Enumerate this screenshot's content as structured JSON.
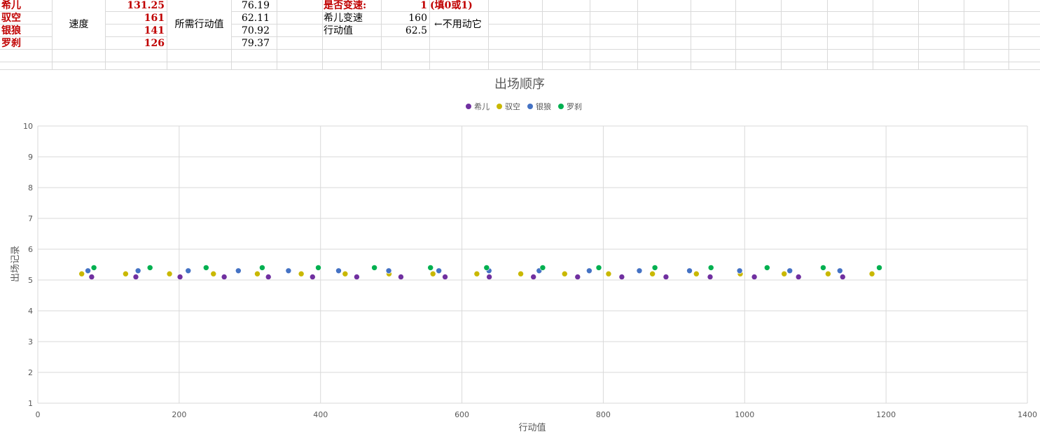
{
  "sheet": {
    "names": [
      "希儿",
      "驭空",
      "银狼",
      "罗刹"
    ],
    "speed_label": "速度",
    "speeds": [
      "131.25",
      "161",
      "141",
      "126"
    ],
    "req_label": "所需行动值",
    "req_values": [
      "76.19",
      "62.11",
      "70.92",
      "79.37"
    ],
    "change_label": "是否变速:",
    "change_value": "1",
    "change_hint": "(填0或1)",
    "seele_speed_label": "希儿变速",
    "seele_speed_value": "160",
    "action_label": "行动值",
    "action_value": "62.5",
    "note": "←不用动它"
  },
  "colors": {
    "希儿": "#7030a0",
    "驭空": "#c9b800",
    "银狼": "#4472c4",
    "罗刹": "#00b050"
  },
  "chart_data": {
    "type": "scatter",
    "title": "出场顺序",
    "xlabel": "行动值",
    "ylabel": "出场记录",
    "xlim": [
      0,
      1400
    ],
    "ylim": [
      1,
      10
    ],
    "xticks": [
      "0",
      "200",
      "400",
      "600",
      "800",
      "1000",
      "1200",
      "1400"
    ],
    "yticks": [
      "1",
      "2",
      "3",
      "4",
      "5",
      "6",
      "7",
      "8",
      "9",
      "10"
    ],
    "legend_position": "top",
    "grid": true,
    "series": [
      {
        "name": "希儿",
        "y": 5.1,
        "x": [
          76.19,
          138.69,
          201.19,
          263.69,
          326.19,
          388.69,
          451.19,
          513.69,
          576.19,
          638.69,
          701.19,
          763.69,
          826.19,
          888.69,
          951.19,
          1013.69,
          1076.19,
          1138.69
        ]
      },
      {
        "name": "驭空",
        "y": 5.2,
        "x": [
          62.11,
          124.22,
          186.34,
          248.45,
          310.56,
          372.67,
          434.78,
          496.89,
          559.01,
          621.12,
          683.23,
          745.34,
          807.45,
          869.56,
          931.68,
          993.79,
          1055.9,
          1118.01,
          1180.12
        ]
      },
      {
        "name": "银狼",
        "y": 5.3,
        "x": [
          70.92,
          141.84,
          212.77,
          283.69,
          354.61,
          425.53,
          496.45,
          567.38,
          638.3,
          709.22,
          780.14,
          851.06,
          921.99,
          992.91,
          1063.83,
          1134.75
        ]
      },
      {
        "name": "罗刹",
        "y": 5.4,
        "x": [
          79.37,
          158.73,
          238.1,
          317.46,
          396.83,
          476.19,
          555.56,
          634.92,
          714.29,
          793.65,
          873.02,
          952.38,
          1031.75,
          1111.11,
          1190.48
        ]
      }
    ]
  }
}
